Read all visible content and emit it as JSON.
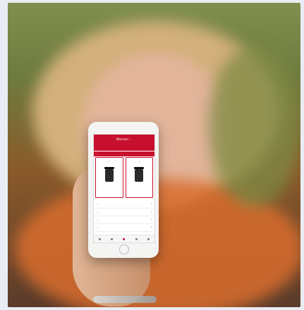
{
  "app": {
    "header_title": "Wanneer ...",
    "section_title": "...",
    "cards": [
      {
        "title": "..."
      },
      {
        "title": "..."
      }
    ],
    "list_items": [
      {
        "label": "..."
      },
      {
        "label": "..."
      },
      {
        "label": "..."
      },
      {
        "label": "..."
      }
    ],
    "tab_count": 5,
    "accent_color": "#c8102e"
  }
}
